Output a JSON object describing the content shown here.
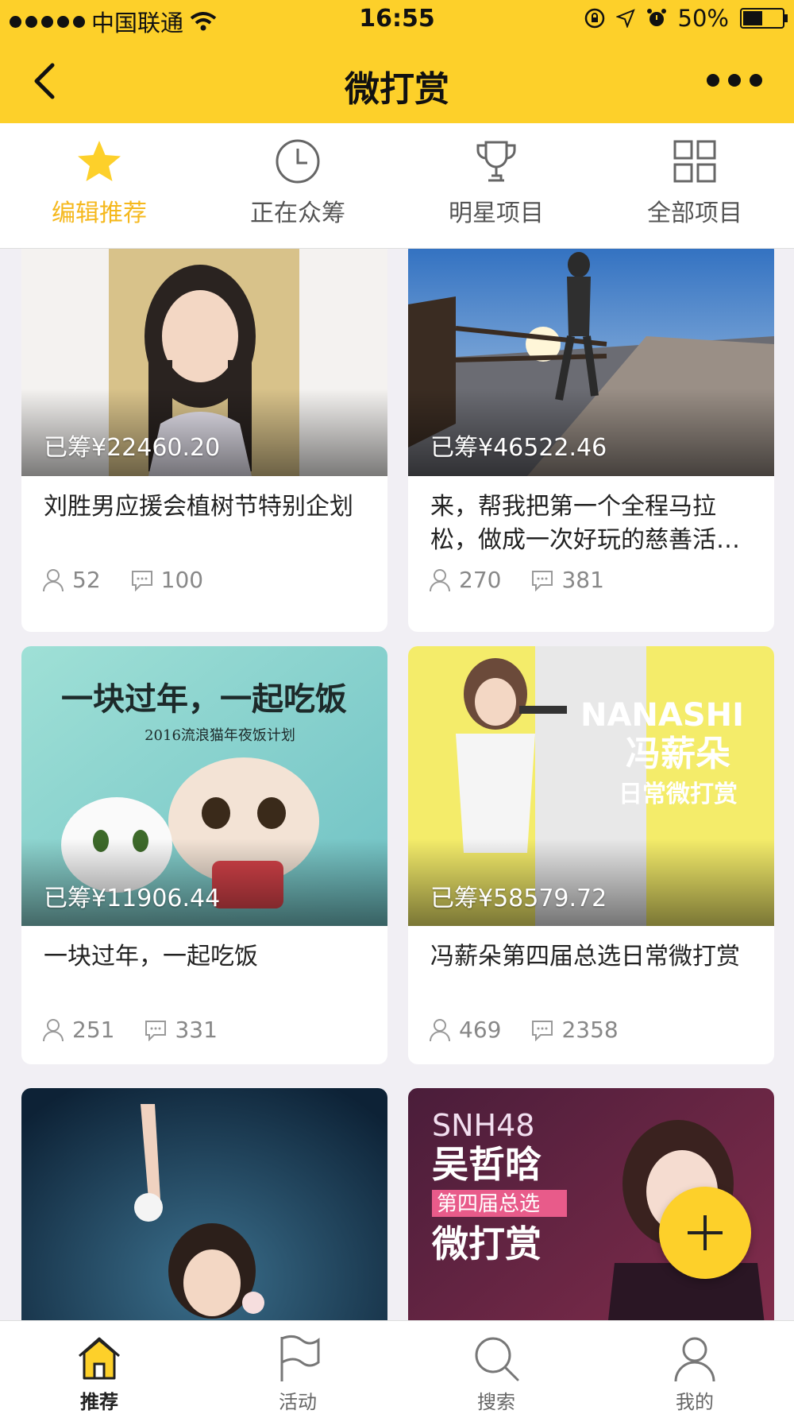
{
  "status_bar": {
    "carrier": "中国联通",
    "time": "16:55",
    "battery": "50%"
  },
  "navbar": {
    "title": "微打赏"
  },
  "tabs": [
    {
      "label": "编辑推荐",
      "icon": "star-icon",
      "active": true
    },
    {
      "label": "正在众筹",
      "icon": "clock-icon",
      "active": false
    },
    {
      "label": "明星项目",
      "icon": "trophy-icon",
      "active": false
    },
    {
      "label": "全部项目",
      "icon": "grid-icon",
      "active": false
    }
  ],
  "projects": [
    {
      "raised": "已筹¥22460.20",
      "title": "刘胜男应援会植树节特别企划",
      "supporters": "52",
      "comments": "100",
      "image": "girl-portrait-photo"
    },
    {
      "raised": "已筹¥46522.46",
      "title": "来，帮我把第一个全程马拉松，做成一次好玩的慈善活…",
      "supporters": "270",
      "comments": "381",
      "image": "runner-on-boardwalk-photo"
    },
    {
      "raised": "已筹¥11906.44",
      "title": "一块过年，一起吃饭",
      "supporters": "251",
      "comments": "331",
      "image": "cartoon-cats-illustration",
      "image_text": {
        "headline": "一块过年，一起吃饭",
        "subline": "2016流浪猫年夜饭计划"
      }
    },
    {
      "raised": "已筹¥58579.72",
      "title": "冯薪朵第四届总选日常微打赏",
      "supporters": "469",
      "comments": "2358",
      "image": "singer-on-yellow-poster",
      "image_text": {
        "brand": "NANASHI",
        "name": "冯薪朵",
        "tagline": "日常微打赏"
      }
    },
    {
      "raised": "",
      "title": "",
      "supporters": "",
      "comments": "",
      "image": "performer-on-stage-photo"
    },
    {
      "raised": "",
      "title": "",
      "supporters": "",
      "comments": "",
      "image": "snh48-poster",
      "image_text": {
        "group": "SNH48",
        "name": "吴哲晗",
        "event": "第四届总选",
        "tagline": "微打赏"
      }
    }
  ],
  "bottom_nav": [
    {
      "label": "推荐",
      "icon": "home-icon",
      "active": true
    },
    {
      "label": "活动",
      "icon": "flag-icon",
      "active": false
    },
    {
      "label": "搜索",
      "icon": "search-icon",
      "active": false
    },
    {
      "label": "我的",
      "icon": "user-icon",
      "active": false
    }
  ],
  "colors": {
    "brand_yellow": "#fdd02a",
    "active_tab": "#f5b81d",
    "background": "#f1eff4"
  }
}
